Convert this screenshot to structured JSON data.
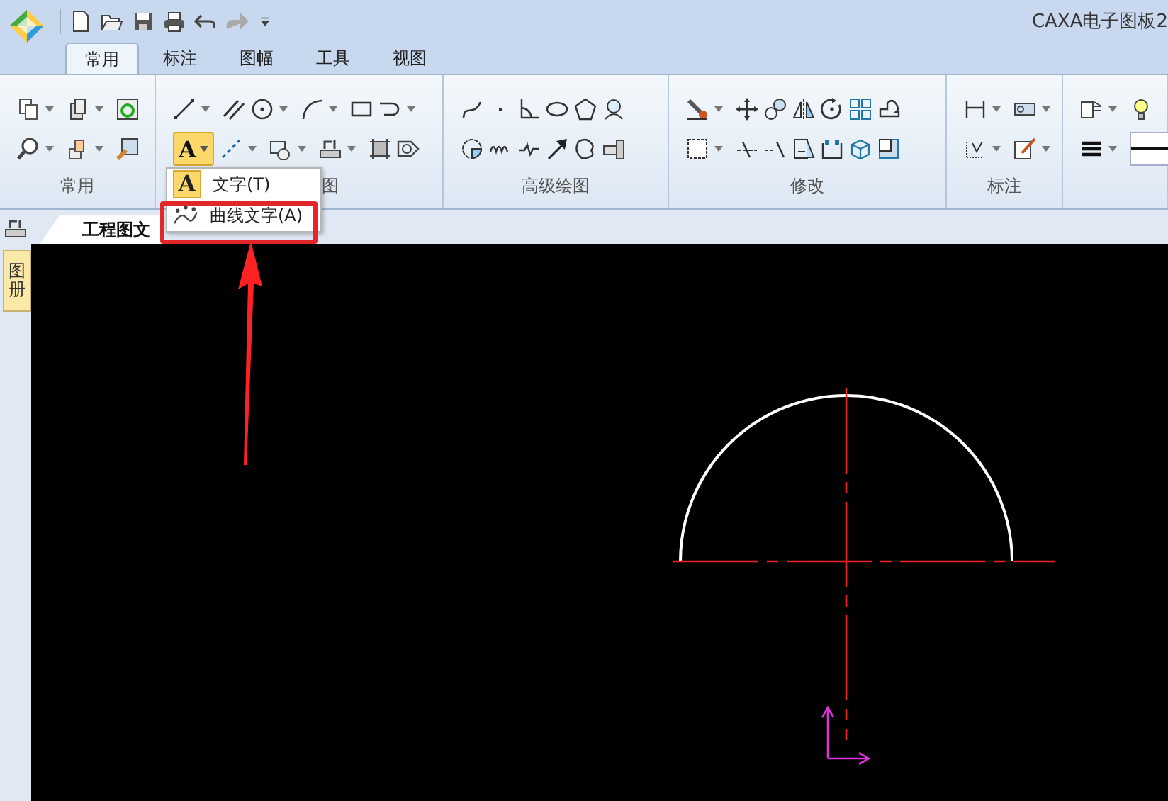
{
  "window": {
    "title": "CAXA电子图板2"
  },
  "tabs": [
    {
      "label": "常用",
      "selected": true
    },
    {
      "label": "标注",
      "selected": false
    },
    {
      "label": "图幅",
      "selected": false
    },
    {
      "label": "工具",
      "selected": false
    },
    {
      "label": "视图",
      "selected": false
    }
  ],
  "ribbon": {
    "groups": [
      {
        "label": "常用"
      },
      {
        "label": "图"
      },
      {
        "label": "高级绘图"
      },
      {
        "label": "修改"
      },
      {
        "label": "标注"
      }
    ],
    "text_tool": {
      "glyph": "A",
      "pressed": true
    }
  },
  "dropdown": {
    "items": [
      {
        "glyph": "A",
        "label": "文字(T)"
      },
      {
        "label": "曲线文字(A)"
      }
    ]
  },
  "document_tabs": [
    {
      "label": "工程图文"
    }
  ],
  "side_panel": {
    "tab": "图册"
  }
}
